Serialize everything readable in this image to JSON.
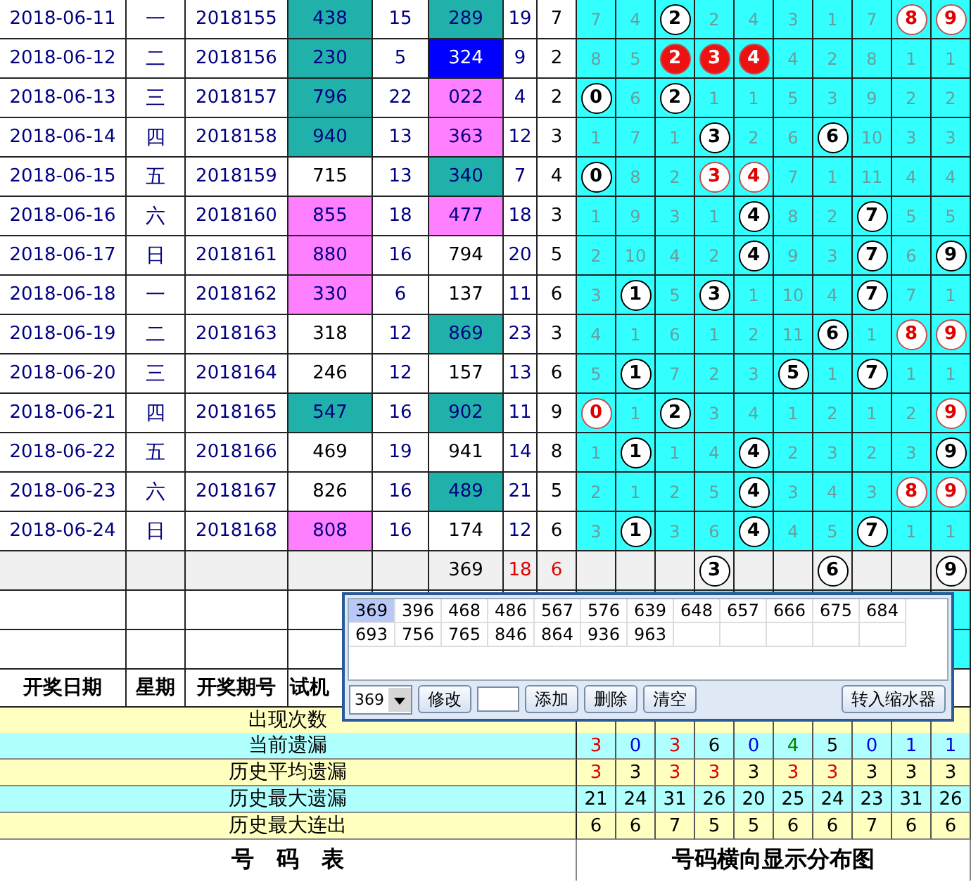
{
  "rows": [
    {
      "date": "2018-06-11",
      "weekday": "一",
      "issue": "2018155",
      "trial": {
        "text": "438",
        "color": "#20b2aa"
      },
      "trial_sum": "15",
      "draw": {
        "text": "289",
        "color": "#20b2aa"
      },
      "draw_sum": "19",
      "span": "7",
      "cells": [
        {
          "text": "7",
          "kind": "miss"
        },
        {
          "text": "4",
          "kind": "miss"
        },
        {
          "text": "2",
          "kind": "hit"
        },
        {
          "text": "2",
          "kind": "miss"
        },
        {
          "text": "4",
          "kind": "miss"
        },
        {
          "text": "3",
          "kind": "miss"
        },
        {
          "text": "1",
          "kind": "miss"
        },
        {
          "text": "7",
          "kind": "miss"
        },
        {
          "text": "8",
          "kind": "hit-red"
        },
        {
          "text": "9",
          "kind": "hit-red"
        }
      ]
    },
    {
      "date": "2018-06-12",
      "weekday": "二",
      "issue": "2018156",
      "trial": {
        "text": "230",
        "color": "#20b2aa"
      },
      "trial_sum": "5",
      "draw": {
        "text": "324",
        "color": "#0000ff"
      },
      "draw_sum": "9",
      "span": "2",
      "cells": [
        {
          "text": "8",
          "kind": "miss"
        },
        {
          "text": "5",
          "kind": "miss"
        },
        {
          "text": "2",
          "kind": "hit-filled"
        },
        {
          "text": "3",
          "kind": "hit-filled"
        },
        {
          "text": "4",
          "kind": "hit-filled"
        },
        {
          "text": "4",
          "kind": "miss"
        },
        {
          "text": "2",
          "kind": "miss"
        },
        {
          "text": "8",
          "kind": "miss"
        },
        {
          "text": "1",
          "kind": "miss"
        },
        {
          "text": "1",
          "kind": "miss"
        }
      ]
    },
    {
      "date": "2018-06-13",
      "weekday": "三",
      "issue": "2018157",
      "trial": {
        "text": "796",
        "color": "#20b2aa"
      },
      "trial_sum": "22",
      "draw": {
        "text": "022",
        "color": "#ff80ff"
      },
      "draw_sum": "4",
      "span": "2",
      "cells": [
        {
          "text": "0",
          "kind": "hit"
        },
        {
          "text": "6",
          "kind": "miss"
        },
        {
          "text": "2",
          "kind": "hit"
        },
        {
          "text": "1",
          "kind": "miss"
        },
        {
          "text": "1",
          "kind": "miss"
        },
        {
          "text": "5",
          "kind": "miss"
        },
        {
          "text": "3",
          "kind": "miss"
        },
        {
          "text": "9",
          "kind": "miss"
        },
        {
          "text": "2",
          "kind": "miss"
        },
        {
          "text": "2",
          "kind": "miss"
        }
      ]
    },
    {
      "date": "2018-06-14",
      "weekday": "四",
      "issue": "2018158",
      "trial": {
        "text": "940",
        "color": "#20b2aa"
      },
      "trial_sum": "13",
      "draw": {
        "text": "363",
        "color": "#ff80ff"
      },
      "draw_sum": "12",
      "span": "3",
      "cells": [
        {
          "text": "1",
          "kind": "miss"
        },
        {
          "text": "7",
          "kind": "miss"
        },
        {
          "text": "1",
          "kind": "miss"
        },
        {
          "text": "3",
          "kind": "hit"
        },
        {
          "text": "2",
          "kind": "miss"
        },
        {
          "text": "6",
          "kind": "miss"
        },
        {
          "text": "6",
          "kind": "hit"
        },
        {
          "text": "10",
          "kind": "miss"
        },
        {
          "text": "3",
          "kind": "miss"
        },
        {
          "text": "3",
          "kind": "miss"
        }
      ]
    },
    {
      "date": "2018-06-15",
      "weekday": "五",
      "issue": "2018159",
      "trial": {
        "text": "715",
        "color": "#ffffff"
      },
      "trial_sum": "13",
      "draw": {
        "text": "340",
        "color": "#20b2aa"
      },
      "draw_sum": "7",
      "span": "4",
      "cells": [
        {
          "text": "0",
          "kind": "hit"
        },
        {
          "text": "8",
          "kind": "miss"
        },
        {
          "text": "2",
          "kind": "miss"
        },
        {
          "text": "3",
          "kind": "hit-red"
        },
        {
          "text": "4",
          "kind": "hit-red"
        },
        {
          "text": "7",
          "kind": "miss"
        },
        {
          "text": "1",
          "kind": "miss"
        },
        {
          "text": "11",
          "kind": "miss"
        },
        {
          "text": "4",
          "kind": "miss"
        },
        {
          "text": "4",
          "kind": "miss"
        }
      ]
    },
    {
      "date": "2018-06-16",
      "weekday": "六",
      "issue": "2018160",
      "trial": {
        "text": "855",
        "color": "#ff80ff"
      },
      "trial_sum": "18",
      "draw": {
        "text": "477",
        "color": "#ff80ff"
      },
      "draw_sum": "18",
      "span": "3",
      "cells": [
        {
          "text": "1",
          "kind": "miss"
        },
        {
          "text": "9",
          "kind": "miss"
        },
        {
          "text": "3",
          "kind": "miss"
        },
        {
          "text": "1",
          "kind": "miss"
        },
        {
          "text": "4",
          "kind": "hit"
        },
        {
          "text": "8",
          "kind": "miss"
        },
        {
          "text": "2",
          "kind": "miss"
        },
        {
          "text": "7",
          "kind": "hit"
        },
        {
          "text": "5",
          "kind": "miss"
        },
        {
          "text": "5",
          "kind": "miss"
        }
      ]
    },
    {
      "date": "2018-06-17",
      "weekday": "日",
      "issue": "2018161",
      "trial": {
        "text": "880",
        "color": "#ff80ff"
      },
      "trial_sum": "16",
      "draw": {
        "text": "794",
        "color": "#ffffff"
      },
      "draw_sum": "20",
      "span": "5",
      "cells": [
        {
          "text": "2",
          "kind": "miss"
        },
        {
          "text": "10",
          "kind": "miss"
        },
        {
          "text": "4",
          "kind": "miss"
        },
        {
          "text": "2",
          "kind": "miss"
        },
        {
          "text": "4",
          "kind": "hit"
        },
        {
          "text": "9",
          "kind": "miss"
        },
        {
          "text": "3",
          "kind": "miss"
        },
        {
          "text": "7",
          "kind": "hit"
        },
        {
          "text": "6",
          "kind": "miss"
        },
        {
          "text": "9",
          "kind": "hit"
        }
      ]
    },
    {
      "date": "2018-06-18",
      "weekday": "一",
      "issue": "2018162",
      "trial": {
        "text": "330",
        "color": "#ff80ff"
      },
      "trial_sum": "6",
      "draw": {
        "text": "137",
        "color": "#ffffff"
      },
      "draw_sum": "11",
      "span": "6",
      "cells": [
        {
          "text": "3",
          "kind": "miss"
        },
        {
          "text": "1",
          "kind": "hit"
        },
        {
          "text": "5",
          "kind": "miss"
        },
        {
          "text": "3",
          "kind": "hit"
        },
        {
          "text": "1",
          "kind": "miss"
        },
        {
          "text": "10",
          "kind": "miss"
        },
        {
          "text": "4",
          "kind": "miss"
        },
        {
          "text": "7",
          "kind": "hit"
        },
        {
          "text": "7",
          "kind": "miss"
        },
        {
          "text": "1",
          "kind": "miss"
        }
      ]
    },
    {
      "date": "2018-06-19",
      "weekday": "二",
      "issue": "2018163",
      "trial": {
        "text": "318",
        "color": "#ffffff"
      },
      "trial_sum": "12",
      "draw": {
        "text": "869",
        "color": "#20b2aa"
      },
      "draw_sum": "23",
      "span": "3",
      "cells": [
        {
          "text": "4",
          "kind": "miss"
        },
        {
          "text": "1",
          "kind": "miss"
        },
        {
          "text": "6",
          "kind": "miss"
        },
        {
          "text": "1",
          "kind": "miss"
        },
        {
          "text": "2",
          "kind": "miss"
        },
        {
          "text": "11",
          "kind": "miss"
        },
        {
          "text": "6",
          "kind": "hit"
        },
        {
          "text": "1",
          "kind": "miss"
        },
        {
          "text": "8",
          "kind": "hit-red"
        },
        {
          "text": "9",
          "kind": "hit-red"
        }
      ]
    },
    {
      "date": "2018-06-20",
      "weekday": "三",
      "issue": "2018164",
      "trial": {
        "text": "246",
        "color": "#ffffff"
      },
      "trial_sum": "12",
      "draw": {
        "text": "157",
        "color": "#ffffff"
      },
      "draw_sum": "13",
      "span": "6",
      "cells": [
        {
          "text": "5",
          "kind": "miss"
        },
        {
          "text": "1",
          "kind": "hit"
        },
        {
          "text": "7",
          "kind": "miss"
        },
        {
          "text": "2",
          "kind": "miss"
        },
        {
          "text": "3",
          "kind": "miss"
        },
        {
          "text": "5",
          "kind": "hit"
        },
        {
          "text": "1",
          "kind": "miss"
        },
        {
          "text": "7",
          "kind": "hit"
        },
        {
          "text": "1",
          "kind": "miss"
        },
        {
          "text": "1",
          "kind": "miss"
        }
      ]
    },
    {
      "date": "2018-06-21",
      "weekday": "四",
      "issue": "2018165",
      "trial": {
        "text": "547",
        "color": "#20b2aa"
      },
      "trial_sum": "16",
      "draw": {
        "text": "902",
        "color": "#20b2aa"
      },
      "draw_sum": "11",
      "span": "9",
      "cells": [
        {
          "text": "0",
          "kind": "hit-red"
        },
        {
          "text": "1",
          "kind": "miss"
        },
        {
          "text": "2",
          "kind": "hit"
        },
        {
          "text": "3",
          "kind": "miss"
        },
        {
          "text": "4",
          "kind": "miss"
        },
        {
          "text": "1",
          "kind": "miss"
        },
        {
          "text": "2",
          "kind": "miss"
        },
        {
          "text": "1",
          "kind": "miss"
        },
        {
          "text": "2",
          "kind": "miss"
        },
        {
          "text": "9",
          "kind": "hit-red"
        }
      ]
    },
    {
      "date": "2018-06-22",
      "weekday": "五",
      "issue": "2018166",
      "trial": {
        "text": "469",
        "color": "#ffffff"
      },
      "trial_sum": "19",
      "draw": {
        "text": "941",
        "color": "#ffffff"
      },
      "draw_sum": "14",
      "span": "8",
      "cells": [
        {
          "text": "1",
          "kind": "miss"
        },
        {
          "text": "1",
          "kind": "hit"
        },
        {
          "text": "1",
          "kind": "miss"
        },
        {
          "text": "4",
          "kind": "miss"
        },
        {
          "text": "4",
          "kind": "hit"
        },
        {
          "text": "2",
          "kind": "miss"
        },
        {
          "text": "3",
          "kind": "miss"
        },
        {
          "text": "2",
          "kind": "miss"
        },
        {
          "text": "3",
          "kind": "miss"
        },
        {
          "text": "9",
          "kind": "hit"
        }
      ]
    },
    {
      "date": "2018-06-23",
      "weekday": "六",
      "issue": "2018167",
      "trial": {
        "text": "826",
        "color": "#ffffff"
      },
      "trial_sum": "16",
      "draw": {
        "text": "489",
        "color": "#20b2aa"
      },
      "draw_sum": "21",
      "span": "5",
      "cells": [
        {
          "text": "2",
          "kind": "miss"
        },
        {
          "text": "1",
          "kind": "miss"
        },
        {
          "text": "2",
          "kind": "miss"
        },
        {
          "text": "5",
          "kind": "miss"
        },
        {
          "text": "4",
          "kind": "hit"
        },
        {
          "text": "3",
          "kind": "miss"
        },
        {
          "text": "4",
          "kind": "miss"
        },
        {
          "text": "3",
          "kind": "miss"
        },
        {
          "text": "8",
          "kind": "hit-red"
        },
        {
          "text": "9",
          "kind": "hit-red"
        }
      ]
    },
    {
      "date": "2018-06-24",
      "weekday": "日",
      "issue": "2018168",
      "trial": {
        "text": "808",
        "color": "#ff80ff"
      },
      "trial_sum": "16",
      "draw": {
        "text": "174",
        "color": "#ffffff"
      },
      "draw_sum": "12",
      "span": "6",
      "cells": [
        {
          "text": "3",
          "kind": "miss"
        },
        {
          "text": "1",
          "kind": "hit"
        },
        {
          "text": "3",
          "kind": "miss"
        },
        {
          "text": "6",
          "kind": "miss"
        },
        {
          "text": "4",
          "kind": "hit"
        },
        {
          "text": "4",
          "kind": "miss"
        },
        {
          "text": "5",
          "kind": "miss"
        },
        {
          "text": "7",
          "kind": "hit"
        },
        {
          "text": "1",
          "kind": "miss"
        },
        {
          "text": "1",
          "kind": "miss"
        }
      ]
    }
  ],
  "totals": {
    "draw": "369",
    "draw_sum": "18",
    "span": "6",
    "cells": [
      {
        "kind": "empty"
      },
      {
        "kind": "empty"
      },
      {
        "kind": "empty"
      },
      {
        "text": "3",
        "kind": "hit"
      },
      {
        "kind": "empty"
      },
      {
        "kind": "empty"
      },
      {
        "text": "6",
        "kind": "hit"
      },
      {
        "kind": "empty"
      },
      {
        "kind": "empty"
      },
      {
        "text": "9",
        "kind": "hit"
      }
    ]
  },
  "header": [
    "开奖日期",
    "星期",
    "开奖期号",
    "试机"
  ],
  "stats": [
    {
      "label": "出现次数"
    },
    {
      "label": "当前遗漏",
      "values": [
        {
          "text": "3",
          "color": "#e00000"
        },
        {
          "text": "0",
          "color": "#0000e0"
        },
        {
          "text": "3",
          "color": "#e00000"
        },
        {
          "text": "6",
          "color": "#000000"
        },
        {
          "text": "0",
          "color": "#0000e0"
        },
        {
          "text": "4",
          "color": "#008000"
        },
        {
          "text": "5",
          "color": "#000000"
        },
        {
          "text": "0",
          "color": "#0000e0"
        },
        {
          "text": "1",
          "color": "#0000e0"
        },
        {
          "text": "1",
          "color": "#0000e0"
        }
      ]
    },
    {
      "label": "历史平均遗漏",
      "values": [
        {
          "text": "3",
          "color": "#e00000"
        },
        {
          "text": "3",
          "color": "#000000"
        },
        {
          "text": "3",
          "color": "#e00000"
        },
        {
          "text": "3",
          "color": "#e00000"
        },
        {
          "text": "3",
          "color": "#000000"
        },
        {
          "text": "3",
          "color": "#e00000"
        },
        {
          "text": "3",
          "color": "#e00000"
        },
        {
          "text": "3",
          "color": "#000000"
        },
        {
          "text": "3",
          "color": "#000000"
        },
        {
          "text": "3",
          "color": "#000000"
        }
      ]
    },
    {
      "label": "历史最大遗漏",
      "values": [
        {
          "text": "21",
          "color": "#000000"
        },
        {
          "text": "24",
          "color": "#000000"
        },
        {
          "text": "31",
          "color": "#000000"
        },
        {
          "text": "26",
          "color": "#000000"
        },
        {
          "text": "20",
          "color": "#000000"
        },
        {
          "text": "25",
          "color": "#000000"
        },
        {
          "text": "24",
          "color": "#000000"
        },
        {
          "text": "23",
          "color": "#000000"
        },
        {
          "text": "31",
          "color": "#000000"
        },
        {
          "text": "26",
          "color": "#000000"
        }
      ]
    },
    {
      "label": "历史最大连出",
      "values": [
        {
          "text": "6",
          "color": "#000000"
        },
        {
          "text": "6",
          "color": "#000000"
        },
        {
          "text": "7",
          "color": "#000000"
        },
        {
          "text": "5",
          "color": "#000000"
        },
        {
          "text": "5",
          "color": "#000000"
        },
        {
          "text": "6",
          "color": "#000000"
        },
        {
          "text": "6",
          "color": "#000000"
        },
        {
          "text": "7",
          "color": "#000000"
        },
        {
          "text": "6",
          "color": "#000000"
        },
        {
          "text": "6",
          "color": "#000000"
        }
      ]
    }
  ],
  "footer": [
    "号　码　表",
    "号码横向显示分布图"
  ],
  "popup": {
    "numbers": [
      {
        "text": "369",
        "selected": true
      },
      {
        "text": "396",
        "selected": false
      },
      {
        "text": "468",
        "selected": false
      },
      {
        "text": "486",
        "selected": false
      },
      {
        "text": "567",
        "selected": false
      },
      {
        "text": "576",
        "selected": false
      },
      {
        "text": "639",
        "selected": false
      },
      {
        "text": "648",
        "selected": false
      },
      {
        "text": "657",
        "selected": false
      },
      {
        "text": "666",
        "selected": false
      },
      {
        "text": "675",
        "selected": false
      },
      {
        "text": "684",
        "selected": false
      },
      {
        "text": "693",
        "selected": false
      },
      {
        "text": "756",
        "selected": false
      },
      {
        "text": "765",
        "selected": false
      },
      {
        "text": "846",
        "selected": false
      },
      {
        "text": "864",
        "selected": false
      },
      {
        "text": "936",
        "selected": false
      },
      {
        "text": "963",
        "selected": false
      }
    ],
    "combo": "369",
    "controls": [
      {
        "kind": "button",
        "label": "修改"
      },
      {
        "kind": "input"
      },
      {
        "kind": "button",
        "label": "添加"
      },
      {
        "kind": "button",
        "label": "删除"
      },
      {
        "kind": "button",
        "label": "清空"
      },
      {
        "kind": "spacer"
      },
      {
        "kind": "button",
        "label": "转入缩水器"
      }
    ]
  }
}
